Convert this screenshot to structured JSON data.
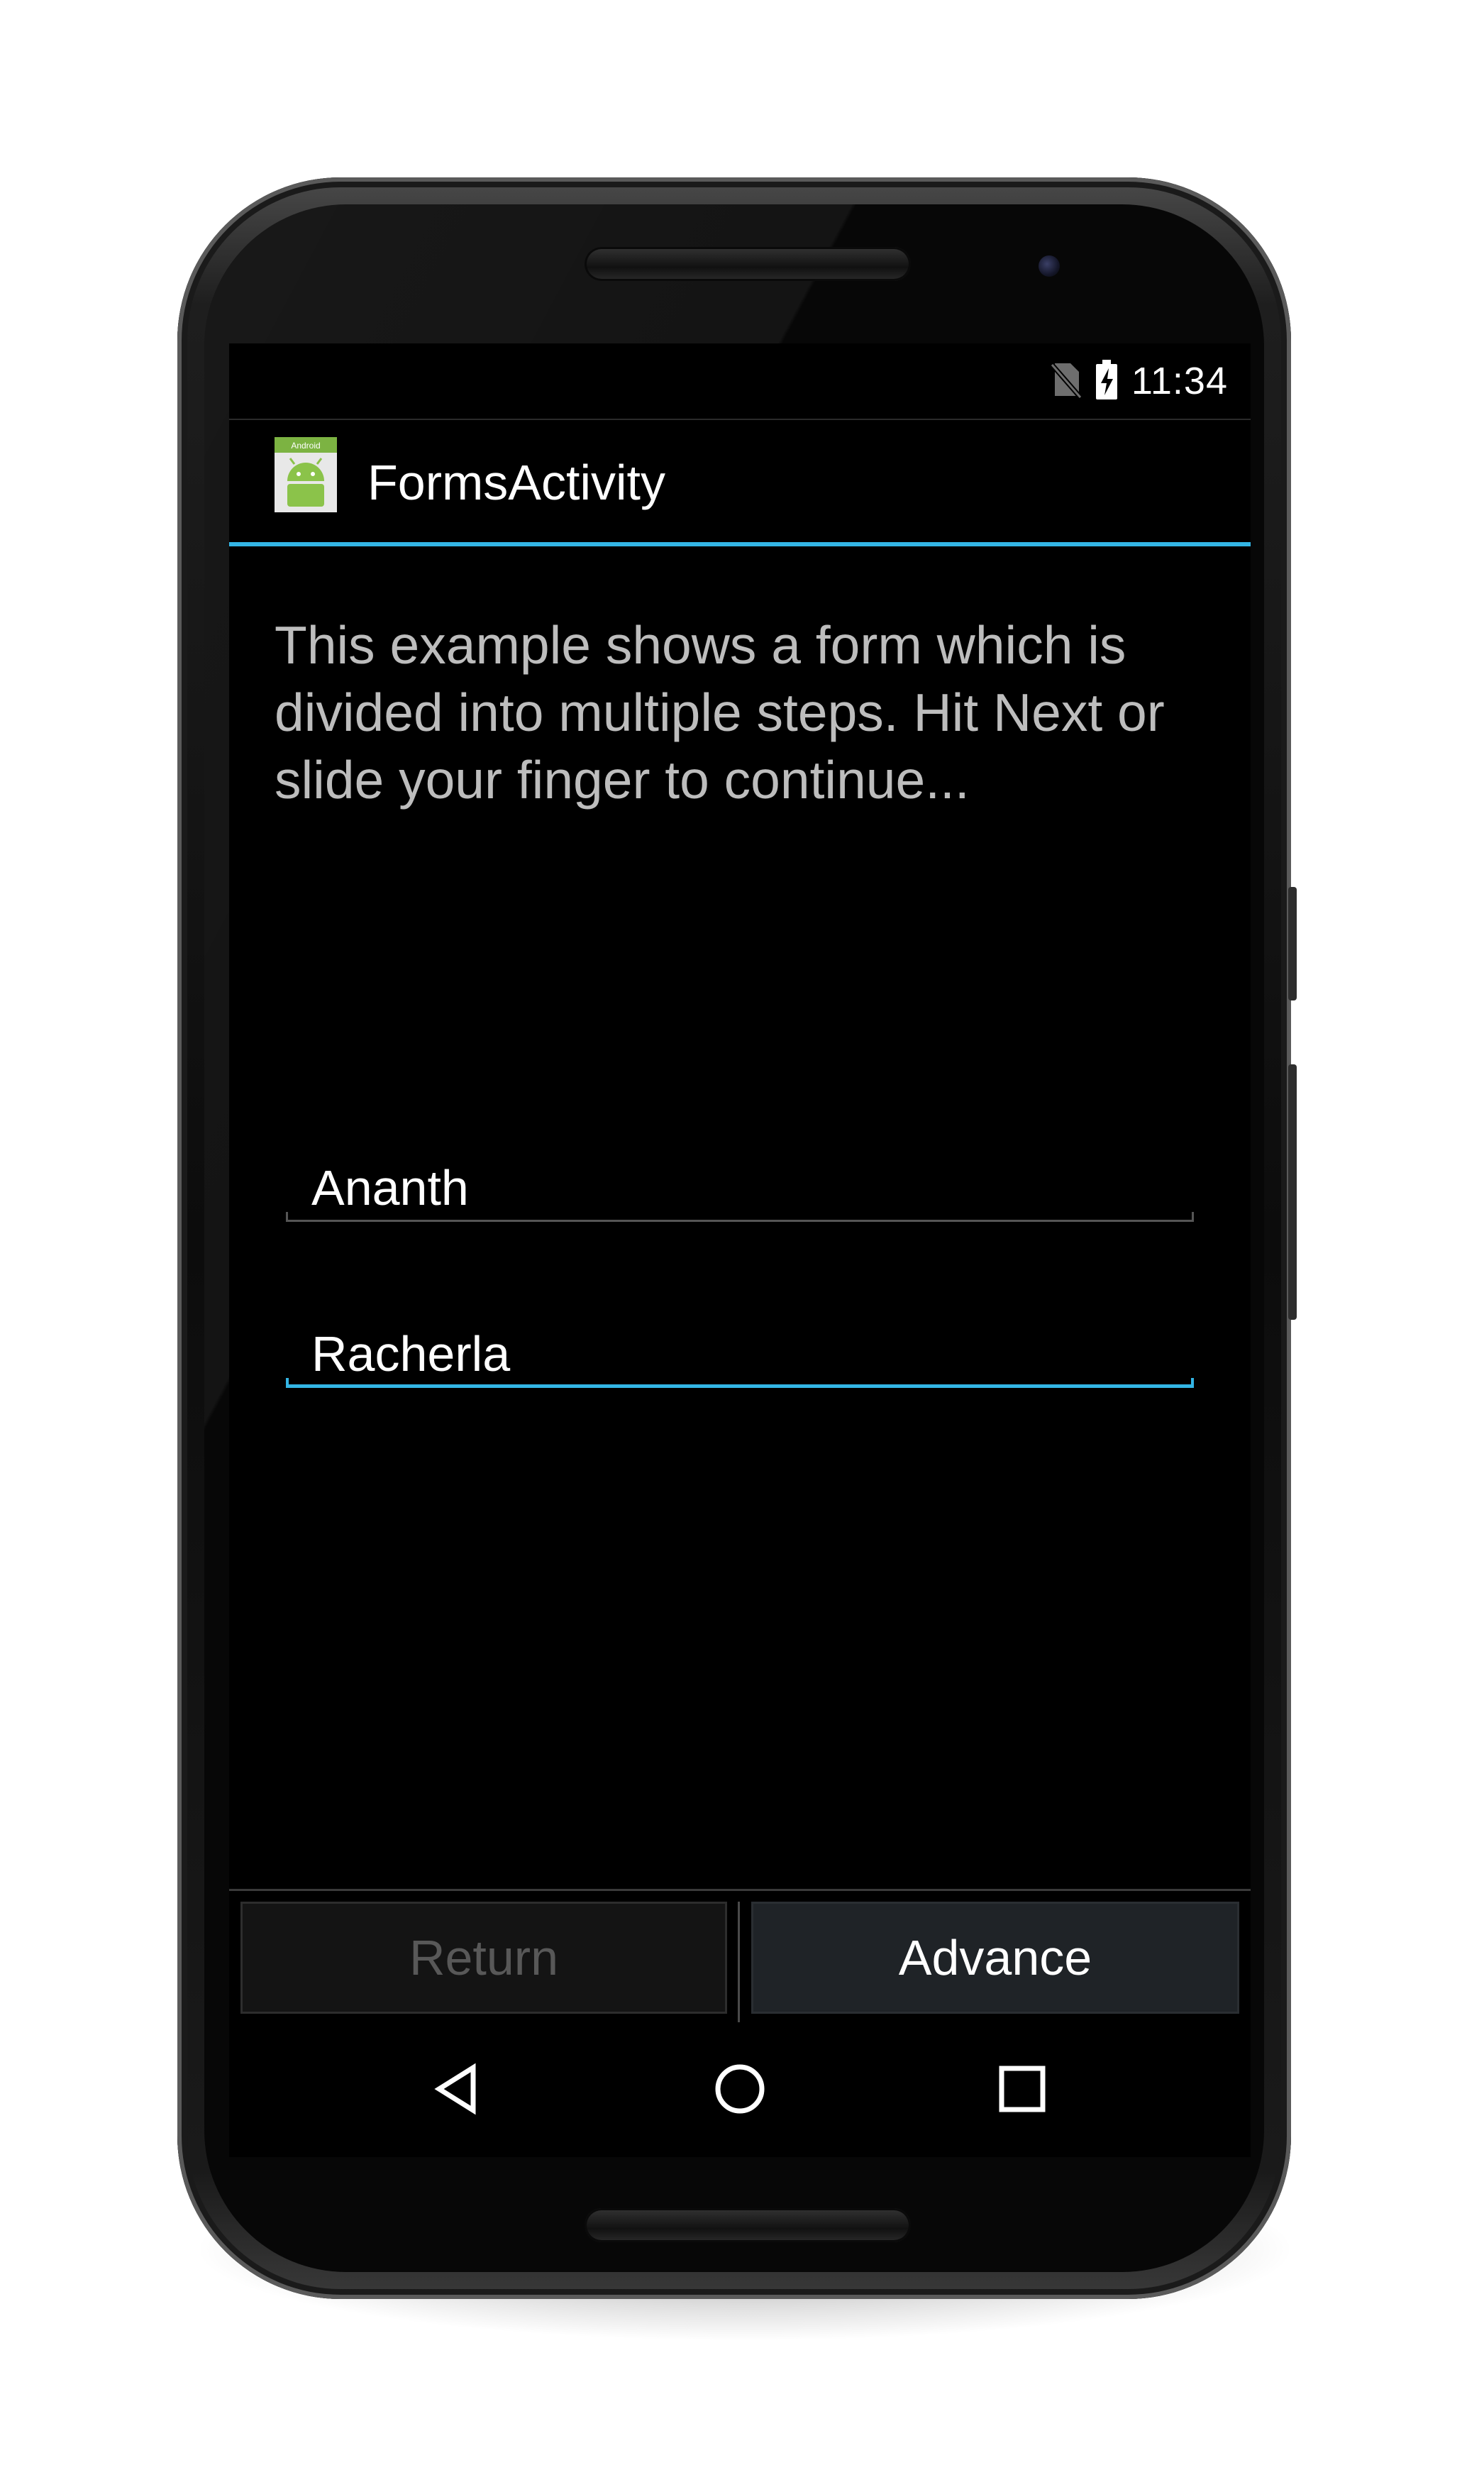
{
  "status_bar": {
    "time": "11:34",
    "icons": [
      "no-sim-icon",
      "battery-charging-icon"
    ]
  },
  "action_bar": {
    "title": "FormsActivity",
    "app_icon": "android-app-icon",
    "app_icon_label": "Android",
    "accent_color": "#33b5e5"
  },
  "content": {
    "intro_text": "This example shows a form which is divided into multiple steps. Hit Next or slide your finger to continue...",
    "fields": [
      {
        "value": "Ananth",
        "focused": false
      },
      {
        "value": "Racherla",
        "focused": true
      }
    ]
  },
  "buttons": {
    "return_label": "Return",
    "advance_label": "Advance"
  },
  "nav_bar": {
    "icons": [
      "back-icon",
      "home-icon",
      "recents-icon"
    ]
  }
}
